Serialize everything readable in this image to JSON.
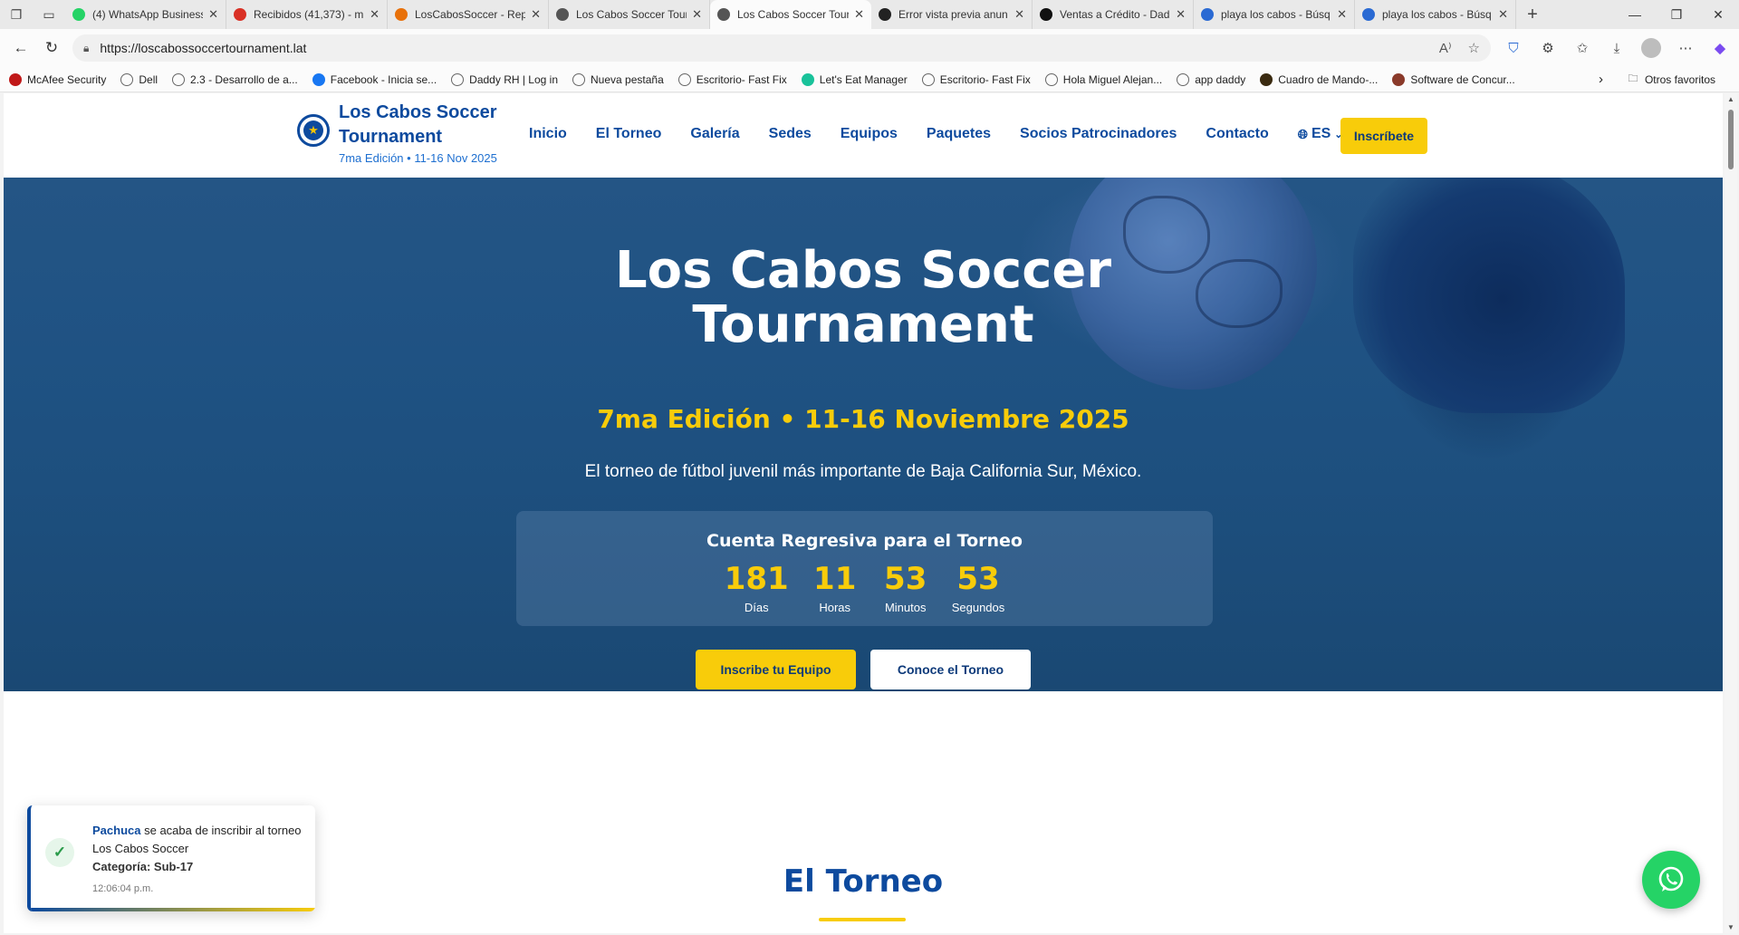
{
  "browser": {
    "tabs": [
      {
        "title": "(4) WhatsApp Business",
        "icon": "whatsapp-icon",
        "color": "#25d366"
      },
      {
        "title": "Recibidos (41,373) - m",
        "icon": "gmail-icon",
        "color": "#d93025"
      },
      {
        "title": "LosCabosSoccer - Rep",
        "icon": "sheets-icon",
        "color": "#e8710a"
      },
      {
        "title": "Los Cabos Soccer Tour",
        "icon": "globe-icon",
        "color": "#555555"
      },
      {
        "title": "Los Cabos Soccer Tour",
        "icon": "globe-icon",
        "color": "#555555",
        "active": true
      },
      {
        "title": "Error vista previa anun",
        "icon": "threads-icon",
        "color": "#222222"
      },
      {
        "title": "Ventas a Crédito - Dad",
        "icon": "notion-icon",
        "color": "#111111"
      },
      {
        "title": "playa los cabos - Búsq",
        "icon": "search-icon",
        "color": "#2a6ad3"
      },
      {
        "title": "playa los cabos - Búsq",
        "icon": "search-icon",
        "color": "#2a6ad3"
      }
    ],
    "url": "https://loscabossoccertournament.lat",
    "bookmarks": [
      {
        "label": "McAfee Security",
        "icon": "mcafee-icon"
      },
      {
        "label": "Dell",
        "icon": "folder-icon"
      },
      {
        "label": "2.3 - Desarrollo de a...",
        "icon": "loading-icon"
      },
      {
        "label": "Facebook - Inicia se...",
        "icon": "facebook-icon"
      },
      {
        "label": "Daddy RH | Log in",
        "icon": "globe-icon"
      },
      {
        "label": "Nueva pestaña",
        "icon": "globe-icon"
      },
      {
        "label": "Escritorio- Fast Fix",
        "icon": "globe-icon"
      },
      {
        "label": "Let's Eat Manager",
        "icon": "app-icon"
      },
      {
        "label": "Escritorio- Fast Fix",
        "icon": "globe-icon"
      },
      {
        "label": "Hola Miguel Alejan...",
        "icon": "grid-icon"
      },
      {
        "label": "app daddy",
        "icon": "globe-icon"
      },
      {
        "label": "Cuadro de Mando-...",
        "icon": "dashboard-icon"
      },
      {
        "label": "Software de Concur...",
        "icon": "software-icon"
      }
    ],
    "other_favorites": "Otros favoritos"
  },
  "site": {
    "logo": {
      "name": "Los Cabos Soccer Tournament",
      "edition": "7ma Edición • 11-16 Nov 2025"
    },
    "menu": [
      "Inicio",
      "El Torneo",
      "Galería",
      "Sedes",
      "Equipos",
      "Paquetes",
      "Socios Patrocinadores",
      "Contacto"
    ],
    "language": "ES",
    "header_cta": "Inscríbete"
  },
  "hero": {
    "title_line1": "Los Cabos Soccer",
    "title_line2": "Tournament",
    "subtitle": "7ma Edición • 11-16 Noviembre 2025",
    "description": "El torneo de fútbol juvenil más importante de Baja California Sur, México.",
    "countdown": {
      "title": "Cuenta Regresiva para el Torneo",
      "units": [
        {
          "value": "181",
          "label": "Días"
        },
        {
          "value": "11",
          "label": "Horas"
        },
        {
          "value": "53",
          "label": "Minutos"
        },
        {
          "value": "53",
          "label": "Segundos"
        }
      ]
    },
    "primary_button": "Inscribe tu Equipo",
    "secondary_button": "Conoce el Torneo"
  },
  "section": {
    "title": "El Torneo"
  },
  "toast": {
    "team": "Pachuca",
    "message": " se acaba de inscribir al torneo Los Cabos Soccer",
    "category": "Categoría: Sub-17",
    "time": "12:06:04 p.m."
  },
  "colors": {
    "brand_blue": "#0d4a9e",
    "accent_yellow": "#f8cc0a",
    "whatsapp_green": "#25d366"
  }
}
